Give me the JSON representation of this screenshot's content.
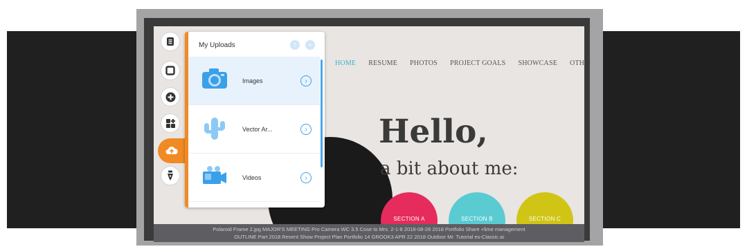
{
  "panel": {
    "title": "My Uploads",
    "help_label": "?",
    "close_label": "×",
    "items": [
      {
        "label": "Images",
        "icon": "camera-icon",
        "chevron": "›"
      },
      {
        "label": "Vector Ar...",
        "icon": "cactus-icon",
        "chevron": "›"
      },
      {
        "label": "Videos",
        "icon": "video-camera-icon",
        "chevron": "›"
      }
    ]
  },
  "rail": {
    "items": [
      {
        "icon": "document-icon"
      },
      {
        "icon": "square-icon"
      },
      {
        "icon": "plus-circle-icon"
      },
      {
        "icon": "apps-icon"
      },
      {
        "icon": "upload-cloud-icon",
        "active": true
      },
      {
        "icon": "pen-icon"
      }
    ]
  },
  "site": {
    "nav": [
      "HOME",
      "RESUME",
      "PHOTOS",
      "PROJECT GOALS",
      "SHOWCASE",
      "OTHER"
    ],
    "hello": "Hello,",
    "subtitle": "a bit about me:",
    "sections": [
      {
        "label": "SECTION A",
        "color": "#e52c5c"
      },
      {
        "label": "SECTION B",
        "color": "#5bcbd2"
      },
      {
        "label": "SECTION C",
        "color": "#d0c515"
      }
    ]
  },
  "ticker": {
    "line1": "Polaroid Frame 2.jpg    MAJOR'S MEETING    Pro Camera WC 3.5    Cose to Mrs. 2-1-8    2018-08-28    2018 Portfolio Share    +lime management",
    "line2": "OUTLINE Part 2018    Resent Show    Project Plan Portfolio    14 GROOK3 APR 22 2018    Outdoor Mr. Tutorial    es-Classic.ai"
  },
  "colors": {
    "accent": "#f08a24",
    "blue": "#3aa0e8",
    "nav_active": "#3fb3c8"
  }
}
